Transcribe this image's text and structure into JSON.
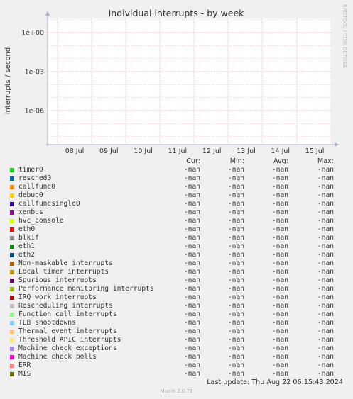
{
  "chart_data": {
    "type": "line",
    "title": "Individual interrupts - by week",
    "ylabel": "interrupts / second",
    "y_scale": "log",
    "y_ticks": [
      "1e+00",
      "1e-03",
      "1e-06"
    ],
    "x_ticks": [
      "08 Jul",
      "09 Jul",
      "10 Jul",
      "11 Jul",
      "12 Jul",
      "13 Jul",
      "14 Jul",
      "15 Jul"
    ],
    "grid": true,
    "side_label": "RRDTOOL / TOBI OETIKER",
    "series": [
      {
        "name": "timer0",
        "color": "#00cc00",
        "cur": "-nan",
        "min": "-nan",
        "avg": "-nan",
        "max": "-nan"
      },
      {
        "name": "resched0",
        "color": "#0066b3",
        "cur": "-nan",
        "min": "-nan",
        "avg": "-nan",
        "max": "-nan"
      },
      {
        "name": "callfunc0",
        "color": "#ff8000",
        "cur": "-nan",
        "min": "-nan",
        "avg": "-nan",
        "max": "-nan"
      },
      {
        "name": "debug0",
        "color": "#ffcc00",
        "cur": "-nan",
        "min": "-nan",
        "avg": "-nan",
        "max": "-nan"
      },
      {
        "name": "callfuncsingle0",
        "color": "#330099",
        "cur": "-nan",
        "min": "-nan",
        "avg": "-nan",
        "max": "-nan"
      },
      {
        "name": "xenbus",
        "color": "#990099",
        "cur": "-nan",
        "min": "-nan",
        "avg": "-nan",
        "max": "-nan"
      },
      {
        "name": "hvc_console",
        "color": "#ccff00",
        "cur": "-nan",
        "min": "-nan",
        "avg": "-nan",
        "max": "-nan"
      },
      {
        "name": "eth0",
        "color": "#ff0000",
        "cur": "-nan",
        "min": "-nan",
        "avg": "-nan",
        "max": "-nan"
      },
      {
        "name": "blkif",
        "color": "#808080",
        "cur": "-nan",
        "min": "-nan",
        "avg": "-nan",
        "max": "-nan"
      },
      {
        "name": "eth1",
        "color": "#008f00",
        "cur": "-nan",
        "min": "-nan",
        "avg": "-nan",
        "max": "-nan"
      },
      {
        "name": "eth2",
        "color": "#00487d",
        "cur": "-nan",
        "min": "-nan",
        "avg": "-nan",
        "max": "-nan"
      },
      {
        "name": "Non-maskable interrupts",
        "color": "#b35a00",
        "cur": "-nan",
        "min": "-nan",
        "avg": "-nan",
        "max": "-nan"
      },
      {
        "name": "Local timer interrupts",
        "color": "#b38f00",
        "cur": "-nan",
        "min": "-nan",
        "avg": "-nan",
        "max": "-nan"
      },
      {
        "name": "Spurious interrupts",
        "color": "#6b006b",
        "cur": "-nan",
        "min": "-nan",
        "avg": "-nan",
        "max": "-nan"
      },
      {
        "name": "Performance monitoring interrupts",
        "color": "#8fb300",
        "cur": "-nan",
        "min": "-nan",
        "avg": "-nan",
        "max": "-nan"
      },
      {
        "name": "IRQ work interrupts",
        "color": "#b30000",
        "cur": "-nan",
        "min": "-nan",
        "avg": "-nan",
        "max": "-nan"
      },
      {
        "name": "Rescheduling interrupts",
        "color": "#bebebe",
        "cur": "-nan",
        "min": "-nan",
        "avg": "-nan",
        "max": "-nan"
      },
      {
        "name": "Function call interrupts",
        "color": "#80ff80",
        "cur": "-nan",
        "min": "-nan",
        "avg": "-nan",
        "max": "-nan"
      },
      {
        "name": "TLB shootdowns",
        "color": "#80c9ff",
        "cur": "-nan",
        "min": "-nan",
        "avg": "-nan",
        "max": "-nan"
      },
      {
        "name": "Thermal event interrupts",
        "color": "#ffc080",
        "cur": "-nan",
        "min": "-nan",
        "avg": "-nan",
        "max": "-nan"
      },
      {
        "name": "Threshold APIC interrupts",
        "color": "#ffe680",
        "cur": "-nan",
        "min": "-nan",
        "avg": "-nan",
        "max": "-nan"
      },
      {
        "name": "Machine check exceptions",
        "color": "#aa80ff",
        "cur": "-nan",
        "min": "-nan",
        "avg": "-nan",
        "max": "-nan"
      },
      {
        "name": "Machine check polls",
        "color": "#ee00cc",
        "cur": "-nan",
        "min": "-nan",
        "avg": "-nan",
        "max": "-nan"
      },
      {
        "name": "ERR",
        "color": "#ff8080",
        "cur": "-nan",
        "min": "-nan",
        "avg": "-nan",
        "max": "-nan"
      },
      {
        "name": "MIS",
        "color": "#666600",
        "cur": "-nan",
        "min": "-nan",
        "avg": "-nan",
        "max": "-nan"
      }
    ]
  },
  "legend_headers": {
    "cur": "Cur:",
    "min": "Min:",
    "avg": "Avg:",
    "max": "Max:"
  },
  "last_update": "Last update: Thu Aug 22 06:15:43 2024",
  "footer": "Munin 2.0.73"
}
